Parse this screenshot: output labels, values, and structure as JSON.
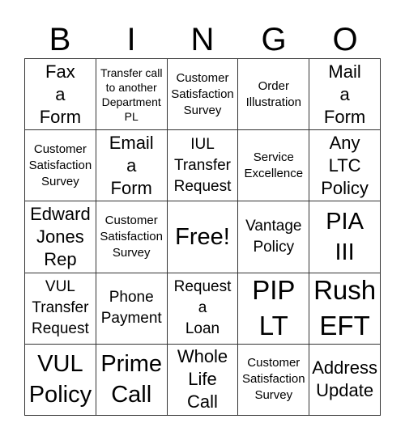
{
  "header": {
    "letters": [
      "B",
      "I",
      "N",
      "G",
      "O"
    ]
  },
  "cells": [
    {
      "text": "Fax\na\nForm",
      "size": "s-lg"
    },
    {
      "text": "Transfer call\nto another\nDepartment\nPL",
      "size": "s-xs"
    },
    {
      "text": "Customer\nSatisfaction\nSurvey",
      "size": "s-sm"
    },
    {
      "text": "Order\nIllustration",
      "size": "s-sm"
    },
    {
      "text": "Mail\na\nForm",
      "size": "s-lg"
    },
    {
      "text": "Customer\nSatisfaction\nSurvey",
      "size": "s-sm"
    },
    {
      "text": "Email\na\nForm",
      "size": "s-lg"
    },
    {
      "text": "IUL\nTransfer\nRequest",
      "size": "s-md"
    },
    {
      "text": "Service\nExcellence",
      "size": "s-sm"
    },
    {
      "text": "Any\nLTC\nPolicy",
      "size": "s-lg"
    },
    {
      "text": "Edward\nJones\nRep",
      "size": "s-lg"
    },
    {
      "text": "Customer\nSatisfaction\nSurvey",
      "size": "s-sm"
    },
    {
      "text": "Free!",
      "size": "s-xl"
    },
    {
      "text": "Vantage\nPolicy",
      "size": "s-md"
    },
    {
      "text": "PIA\nIII",
      "size": "s-xl"
    },
    {
      "text": "VUL\nTransfer\nRequest",
      "size": "s-md"
    },
    {
      "text": "Phone\nPayment",
      "size": "s-md"
    },
    {
      "text": "Request\na\nLoan",
      "size": "s-md"
    },
    {
      "text": "PIP\nLT",
      "size": "s-xxl"
    },
    {
      "text": "Rush\nEFT",
      "size": "s-xxl"
    },
    {
      "text": "VUL\nPolicy",
      "size": "s-xl"
    },
    {
      "text": "Prime\nCall",
      "size": "s-xl"
    },
    {
      "text": "Whole\nLife\nCall",
      "size": "s-lg"
    },
    {
      "text": "Customer\nSatisfaction\nSurvey",
      "size": "s-sm"
    },
    {
      "text": "Address\nUpdate",
      "size": "s-lg"
    }
  ]
}
